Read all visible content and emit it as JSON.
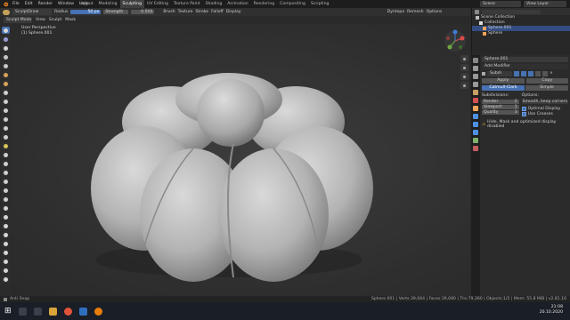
{
  "app": {
    "menus": [
      "File",
      "Edit",
      "Render",
      "Window",
      "Help"
    ],
    "workspace_tabs": [
      "Layout",
      "Modeling",
      "Sculpting",
      "UV Editing",
      "Texture Paint",
      "Shading",
      "Animation",
      "Rendering",
      "Compositing",
      "Scripting"
    ],
    "active_tab": "Sculpting",
    "scene": "Scene",
    "view_layer": "View Layer"
  },
  "tool_header": {
    "brush": "SculptDraw",
    "radius_label": "Radius",
    "radius_value": "50 px",
    "strength_label": "Strength",
    "strength_value": "0.500",
    "brush_menu": "Brush",
    "texture_menu": "Texture",
    "stroke_menu": "Stroke",
    "falloff_menu": "Falloff",
    "display_menu": "Display"
  },
  "right_header": {
    "dyntopo": "Dyntopo",
    "remesh": "Remesh",
    "options": "Options"
  },
  "viewport_header": {
    "mode": "Sculpt Mode",
    "view": "View",
    "sculpt": "Sculpt",
    "mask": "Mask"
  },
  "viewport_info": {
    "perspective": "User Perspective",
    "object": "(1) Sphere.001"
  },
  "outliner": {
    "scene_collection": "Scene Collection",
    "items": [
      {
        "label": "Collection",
        "selected": false
      },
      {
        "label": "Sphere.001",
        "selected": true
      },
      {
        "label": "Sphere",
        "selected": false
      }
    ]
  },
  "properties": {
    "object_name": "Sphere.001",
    "add_modifier": "Add Modifier",
    "modifier_name": "Subdi",
    "apply": "Apply",
    "copy": "Copy",
    "catmull_clark": "Catmull-Clark",
    "simple": "Simple",
    "subdivisions_label": "Subdivisions:",
    "options_label": "Options:",
    "render_label": "Render",
    "render_value": "2",
    "viewport_label": "Viewport",
    "viewport_value": "1",
    "quality_label": "Quality",
    "quality_value": "3",
    "uv_smooth": "Smooth, keep corners",
    "optimal_display": "Optimal Display",
    "use_creases": "Use Creases",
    "warning": "Hide, Mask and optimized display disabled"
  },
  "status": {
    "left_action": "Anti Snap",
    "stats": "Sphere.001 | Verts:39,664 | Faces:39,680 | Tris:79,360 | Objects:1/2 | Mem: 55.8 MiB | v2.81.16"
  },
  "taskbar": {
    "time": "21:08",
    "date": "20.10.2020"
  },
  "colors": {
    "accent": "#4772b3",
    "selection": "#334d80",
    "background": "#2b2b2b",
    "mesh": "#bdbdbd"
  }
}
